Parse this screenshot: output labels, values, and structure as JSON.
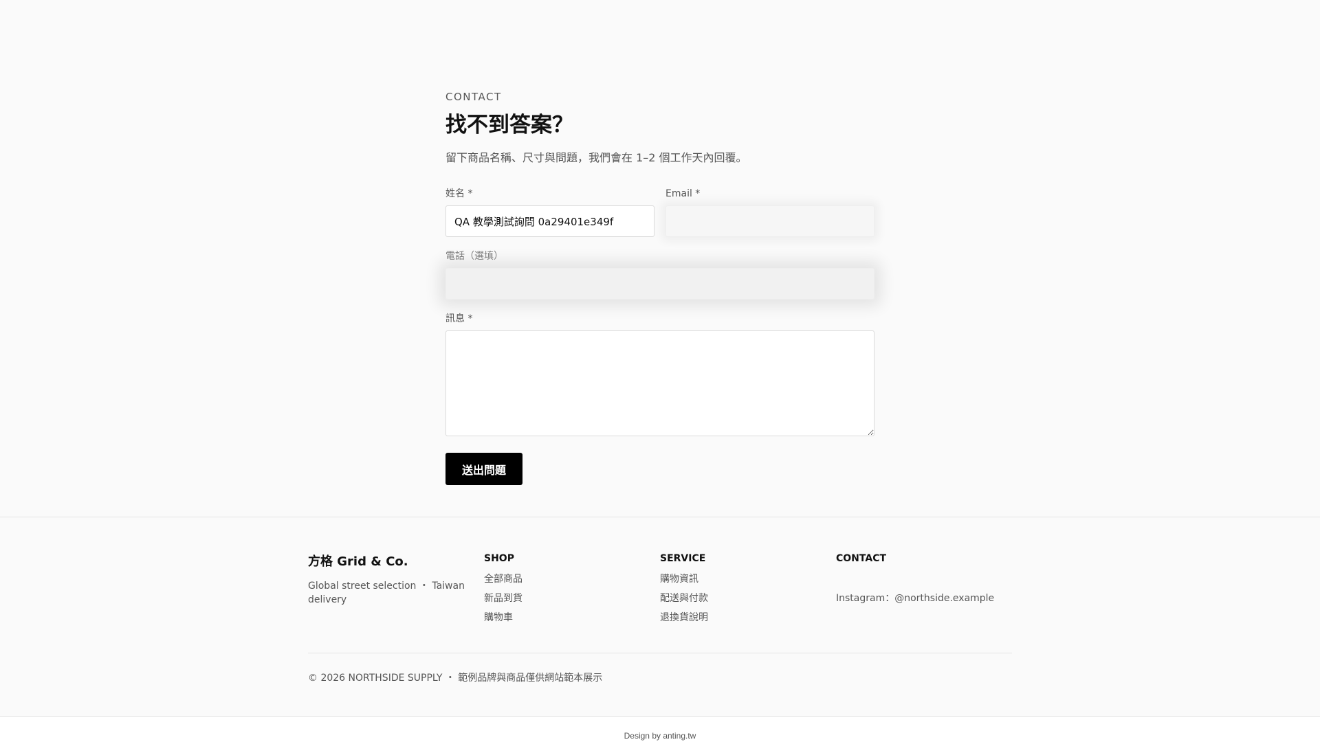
{
  "contact": {
    "eyebrow": "CONTACT",
    "title": "找不到答案？",
    "lead": "留下商品名稱、尺寸與問題，我們會在 1–2 個工作天內回覆。",
    "form": {
      "name_label": "姓名 *",
      "name_value": "QA 教學測試詢問 0a29401e349f",
      "email_label": "Email *",
      "email_value": "",
      "phone_label": "電話（選填）",
      "phone_value": "",
      "message_label": "訊息 *",
      "message_value": "",
      "submit_label": "送出問題"
    }
  },
  "footer": {
    "brand": "方格 Grid & Co.",
    "tagline": "Global street selection ・ Taiwan delivery",
    "shop": {
      "heading": "SHOP",
      "links": [
        "全部商品",
        "新品到貨",
        "購物車"
      ]
    },
    "service": {
      "heading": "SERVICE",
      "links": [
        "購物資訊",
        "配送與付款",
        "退換貨說明"
      ]
    },
    "contact": {
      "heading": "CONTACT",
      "instagram": "Instagram：@northside.example"
    },
    "copyright": "© 2026 NORTHSIDE SUPPLY ・ 範例品牌與商品僅供網站範本展示"
  },
  "credit": "Design by anting.tw"
}
